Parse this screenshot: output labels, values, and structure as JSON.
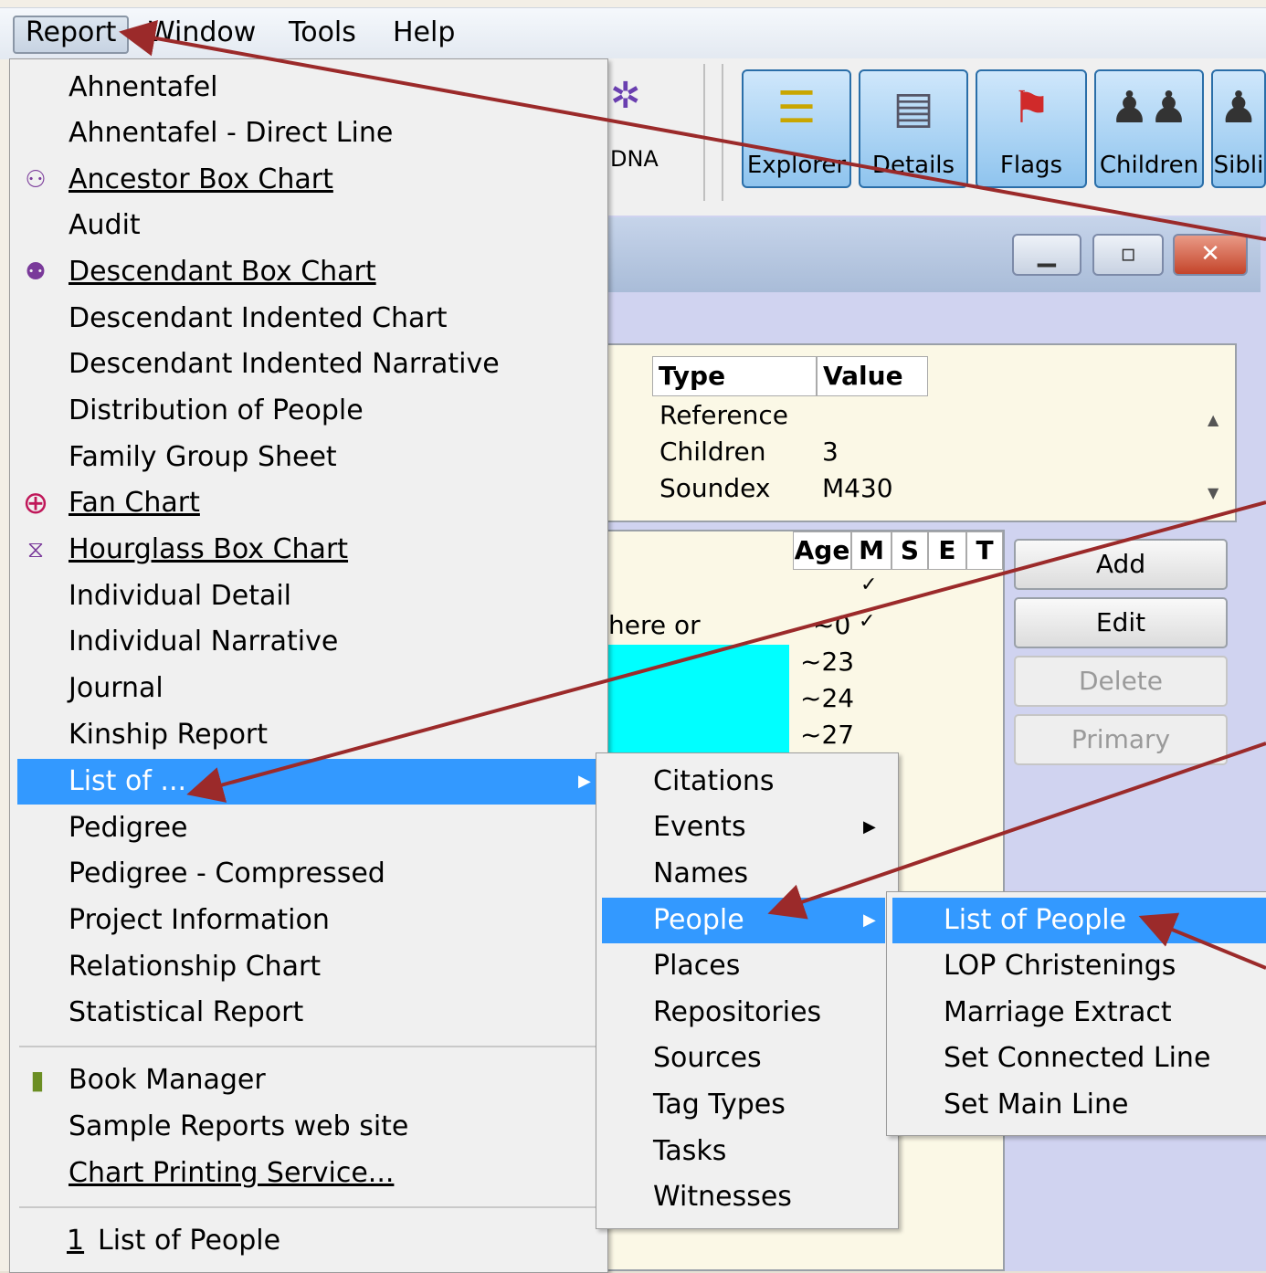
{
  "menubar": {
    "report": "Report",
    "window": "Window",
    "tools": "Tools",
    "help": "Help"
  },
  "toolbar": {
    "dna_label": "DNA",
    "buttons": [
      "Explorer",
      "Details",
      "Flags",
      "Children",
      "Sibli"
    ]
  },
  "info_grid": {
    "headers": [
      "Type",
      "Value"
    ],
    "rows": [
      {
        "type": "Reference",
        "value": ""
      },
      {
        "type": "Children",
        "value": "3"
      },
      {
        "type": "Soundex",
        "value": "M430"
      }
    ]
  },
  "events_grid": {
    "headers": [
      "Age",
      "M",
      "S",
      "E",
      "T"
    ],
    "partial_text": "here or",
    "ages": [
      "~0",
      "~23",
      "~24",
      "~27"
    ],
    "check": "✓"
  },
  "side_buttons": {
    "add": "Add",
    "edit": "Edit",
    "delete": "Delete",
    "primary": "Primary"
  },
  "report_menu": {
    "items": [
      {
        "label": "Ahnentafel",
        "icon": ""
      },
      {
        "label": "Ahnentafel - Direct Line",
        "icon": ""
      },
      {
        "label": "Ancestor Box Chart",
        "icon": "ancestor-chart-icon"
      },
      {
        "label": "Audit",
        "icon": ""
      },
      {
        "label": "Descendant Box Chart",
        "icon": "descendant-chart-icon"
      },
      {
        "label": "Descendant Indented Chart",
        "icon": ""
      },
      {
        "label": "Descendant Indented Narrative",
        "icon": ""
      },
      {
        "label": "Distribution of People",
        "icon": ""
      },
      {
        "label": "Family Group Sheet",
        "icon": ""
      },
      {
        "label": "Fan Chart",
        "icon": "fan-chart-icon"
      },
      {
        "label": "Hourglass Box Chart",
        "icon": "hourglass-chart-icon"
      },
      {
        "label": "Individual Detail",
        "icon": ""
      },
      {
        "label": "Individual Narrative",
        "icon": ""
      },
      {
        "label": "Journal",
        "icon": ""
      },
      {
        "label": "Kinship Report",
        "icon": ""
      },
      {
        "label": "List of ...",
        "icon": ""
      },
      {
        "label": "Pedigree",
        "icon": ""
      },
      {
        "label": "Pedigree - Compressed",
        "icon": ""
      },
      {
        "label": "Project Information",
        "icon": ""
      },
      {
        "label": "Relationship Chart",
        "icon": ""
      },
      {
        "label": "Statistical Report",
        "icon": ""
      }
    ],
    "extra": [
      {
        "label": "Book Manager",
        "icon": "book-icon"
      },
      {
        "label": "Sample Reports web site",
        "icon": ""
      },
      {
        "label": "Chart Printing Service...",
        "icon": ""
      }
    ],
    "recent_number": "1",
    "recent_label": "List of People"
  },
  "list_of_menu": {
    "items": [
      "Citations",
      "Events",
      "Names",
      "People",
      "Places",
      "Repositories",
      "Sources",
      "Tag Types",
      "Tasks",
      "Witnesses"
    ]
  },
  "people_menu": {
    "items": [
      "List of People",
      "LOP Christenings",
      "Marriage Extract",
      "Set Connected Line",
      "Set Main Line"
    ]
  },
  "colors": {
    "highlight": "#3399ff",
    "arrow": "#9b2a2a",
    "window_bg": "#d0d3f0"
  }
}
